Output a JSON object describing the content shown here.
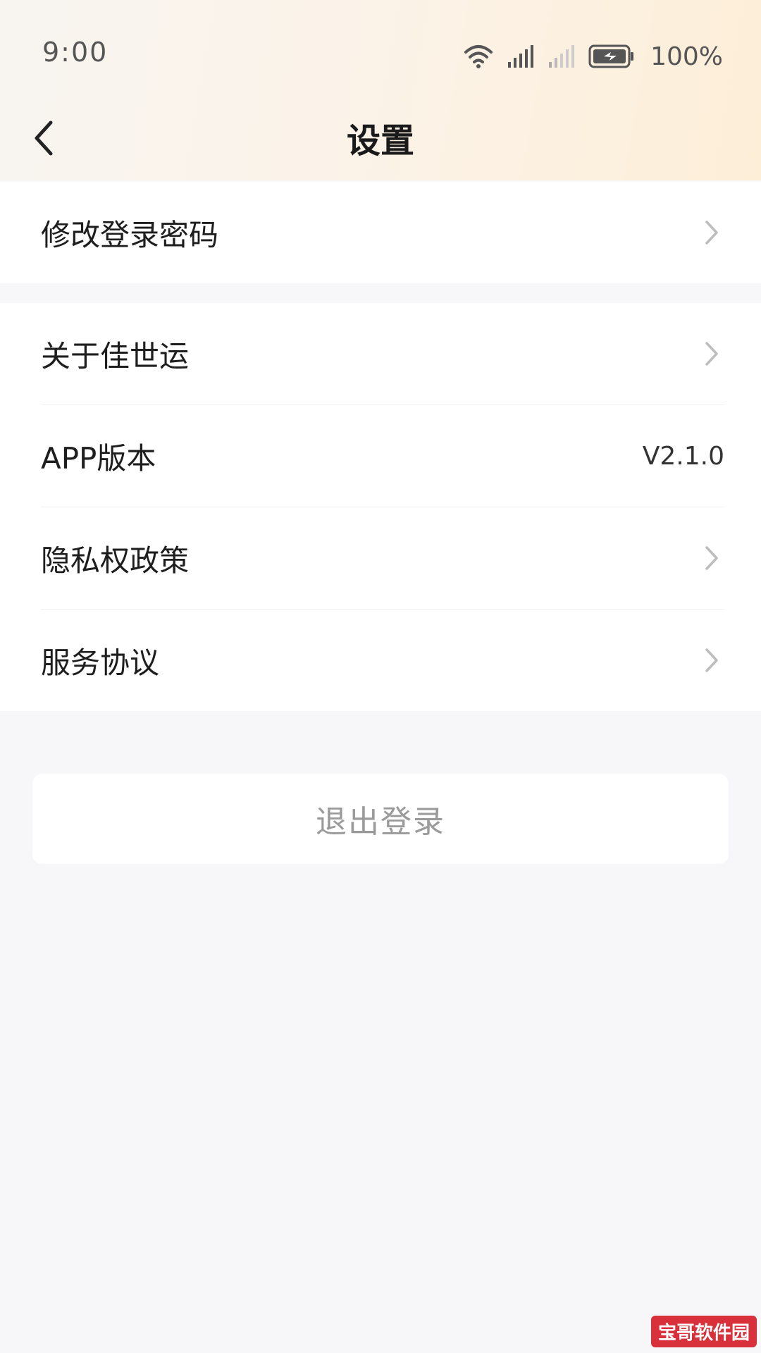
{
  "status_bar": {
    "time": "9:00",
    "battery": "100%",
    "icons": [
      "wifi-icon",
      "signal-icon",
      "signal-weak-icon",
      "battery-charging-icon"
    ]
  },
  "nav": {
    "title": "设置",
    "back_icon": "chevron-left-icon"
  },
  "groups": [
    {
      "items": [
        {
          "label": "修改登录密码",
          "type": "link"
        }
      ]
    },
    {
      "items": [
        {
          "label": "关于佳世运",
          "type": "link"
        },
        {
          "label": "APP版本",
          "type": "value",
          "value": "V2.1.0"
        },
        {
          "label": "隐私权政策",
          "type": "link"
        },
        {
          "label": "服务协议",
          "type": "link"
        }
      ]
    }
  ],
  "logout_label": "退出登录",
  "watermark": "宝哥软件园",
  "colors": {
    "header_gradient_start": "#f8f4f0",
    "header_gradient_end": "#fdeed8",
    "page_bg": "#f7f7f9",
    "logout_text": "#9a9a9a",
    "watermark_bg": "#d8313b"
  }
}
